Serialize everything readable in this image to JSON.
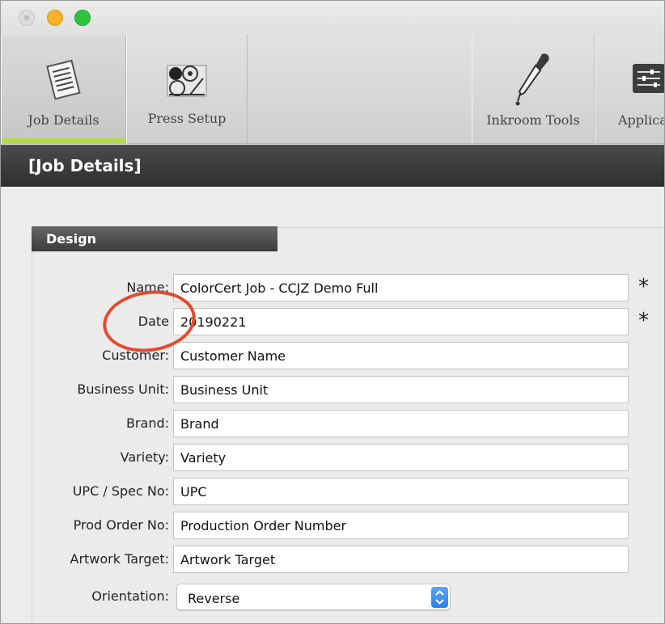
{
  "toolbar": {
    "tabs": [
      {
        "label": "Job Details",
        "icon": "document-list-icon",
        "active": true
      },
      {
        "label": "Press Setup",
        "icon": "press-rollers-icon",
        "active": false
      },
      {
        "label": "Inkroom Tools",
        "icon": "dropper-pen-icon",
        "active": false
      },
      {
        "label": "Applica",
        "icon": "sliders-icon",
        "active": false
      }
    ]
  },
  "header": {
    "title": "[Job Details]"
  },
  "design": {
    "title": "Design",
    "fields": [
      {
        "label": "Name:",
        "value": "ColorCert Job - CCJZ Demo Full",
        "required": "*"
      },
      {
        "label": "Date",
        "value": "20190221",
        "required": "*"
      },
      {
        "label": "Customer:",
        "value": "Customer Name"
      },
      {
        "label": "Business Unit:",
        "value": "Business Unit"
      },
      {
        "label": "Brand:",
        "value": "Brand"
      },
      {
        "label": "Variety:",
        "value": "Variety"
      },
      {
        "label": "UPC / Spec No:",
        "value": "UPC"
      },
      {
        "label": "Prod Order No:",
        "value": "Production Order Number"
      },
      {
        "label": "Artwork Target:",
        "value": "Artwork Target"
      }
    ],
    "orientation": {
      "label": "Orientation:",
      "value": "Reverse"
    }
  },
  "colors": {
    "accent_underline": "#b5d94d",
    "annotation_circle": "#e24a2f",
    "stepper_blue": "#2b7ff2"
  }
}
